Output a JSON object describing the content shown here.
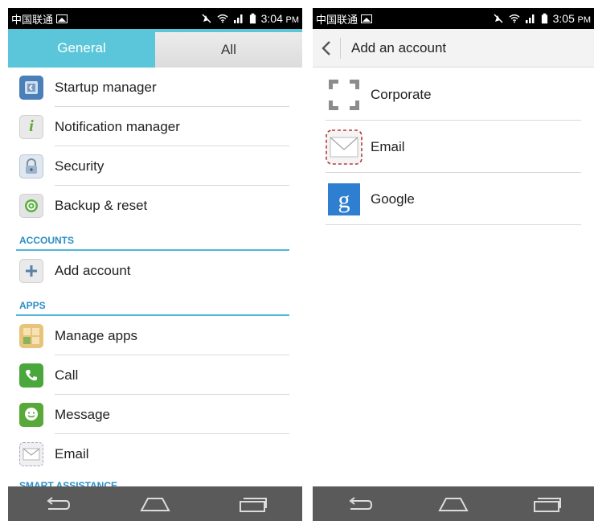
{
  "left": {
    "status": {
      "carrier": "中国联通",
      "time": "3:04",
      "ampm": "PM"
    },
    "tabs": [
      {
        "label": "General"
      },
      {
        "label": "All"
      }
    ],
    "items_top": [
      {
        "label": "Startup manager",
        "icon": "startup-manager-icon"
      },
      {
        "label": "Notification manager",
        "icon": "notification-manager-icon"
      },
      {
        "label": "Security",
        "icon": "lock-icon"
      },
      {
        "label": "Backup & reset",
        "icon": "backup-icon"
      }
    ],
    "sections": {
      "accounts": "ACCOUNTS",
      "apps": "APPS",
      "smart": "SMART ASSISTANCE"
    },
    "accounts_items": [
      {
        "label": "Add account",
        "icon": "plus-icon"
      }
    ],
    "apps_items": [
      {
        "label": "Manage apps",
        "icon": "manage-apps-icon"
      },
      {
        "label": "Call",
        "icon": "phone-icon"
      },
      {
        "label": "Message",
        "icon": "message-icon"
      },
      {
        "label": "Email",
        "icon": "email-icon"
      }
    ]
  },
  "right": {
    "status": {
      "carrier": "中国联通",
      "time": "3:05",
      "ampm": "PM"
    },
    "title": "Add an account",
    "accounts": [
      {
        "label": "Corporate",
        "icon": "corporate-icon"
      },
      {
        "label": "Email",
        "icon": "email-icon"
      },
      {
        "label": "Google",
        "icon": "google-icon"
      }
    ]
  },
  "colors": {
    "accent": "#5bc6da",
    "section_text": "#2a8fc4",
    "navbar": "#5a5a5a",
    "statusbar": "#000000"
  }
}
